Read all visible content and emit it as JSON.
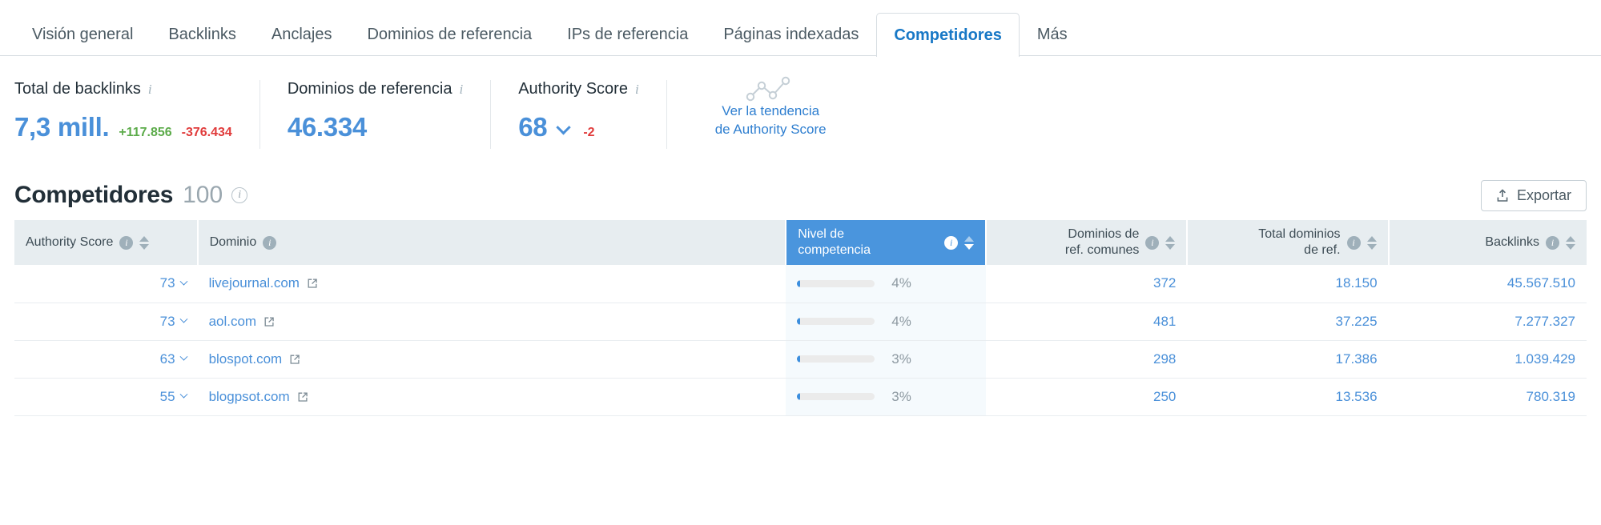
{
  "tabs": [
    {
      "label": "Visión general",
      "active": false
    },
    {
      "label": "Backlinks",
      "active": false
    },
    {
      "label": "Anclajes",
      "active": false
    },
    {
      "label": "Dominios de referencia",
      "active": false
    },
    {
      "label": "IPs de referencia",
      "active": false
    },
    {
      "label": "Páginas indexadas",
      "active": false
    },
    {
      "label": "Competidores",
      "active": true
    },
    {
      "label": "Más",
      "active": false
    }
  ],
  "metrics": [
    {
      "label": "Total de backlinks",
      "value": "7,3 mill.",
      "delta_up": "+117.856",
      "delta_down": "-376.434"
    },
    {
      "label": "Dominios de referencia",
      "value": "46.334"
    },
    {
      "label": "Authority Score",
      "value": "68",
      "delta_down": "-2"
    }
  ],
  "trend": {
    "line1": "Ver la tendencia",
    "line2": "de Authority Score"
  },
  "section": {
    "title": "Competidores",
    "count": "100",
    "info": "i",
    "export_label": "Exportar"
  },
  "table": {
    "columns": [
      {
        "label": "Authority Score",
        "align": "left",
        "highlight": false,
        "info": true,
        "sortable": true
      },
      {
        "label": "Dominio",
        "align": "left",
        "highlight": false,
        "info": true,
        "sortable": false
      },
      {
        "label_line1": "Nivel de",
        "label_line2": "competencia",
        "align": "left",
        "highlight": true,
        "info": true,
        "sortable": true
      },
      {
        "label_line1": "Dominios de",
        "label_line2": "ref. comunes",
        "align": "right",
        "highlight": false,
        "info": true,
        "sortable": true
      },
      {
        "label_line1": "Total dominios",
        "label_line2": "de ref.",
        "align": "right",
        "highlight": false,
        "info": true,
        "sortable": true
      },
      {
        "label": "Backlinks",
        "align": "right",
        "highlight": false,
        "info": true,
        "sortable": true
      }
    ],
    "rows": [
      {
        "authority_score": "73",
        "domain": "livejournal.com",
        "competition_pct": "4%",
        "competition_fill": 4,
        "common_ref_domains": "372",
        "total_ref_domains": "18.150",
        "backlinks": "45.567.510"
      },
      {
        "authority_score": "73",
        "domain": "aol.com",
        "competition_pct": "4%",
        "competition_fill": 4,
        "common_ref_domains": "481",
        "total_ref_domains": "37.225",
        "backlinks": "7.277.327"
      },
      {
        "authority_score": "63",
        "domain": "blospot.com",
        "competition_pct": "3%",
        "competition_fill": 3,
        "common_ref_domains": "298",
        "total_ref_domains": "17.386",
        "backlinks": "1.039.429"
      },
      {
        "authority_score": "55",
        "domain": "blogpsot.com",
        "competition_pct": "3%",
        "competition_fill": 3,
        "common_ref_domains": "250",
        "total_ref_domains": "13.536",
        "backlinks": "780.319"
      }
    ]
  },
  "colors": {
    "accent_blue": "#4a90d9",
    "header_blue": "#4a95dd",
    "header_grey": "#e7edf0",
    "positive_green": "#5cab4a",
    "negative_red": "#e03b3b"
  }
}
